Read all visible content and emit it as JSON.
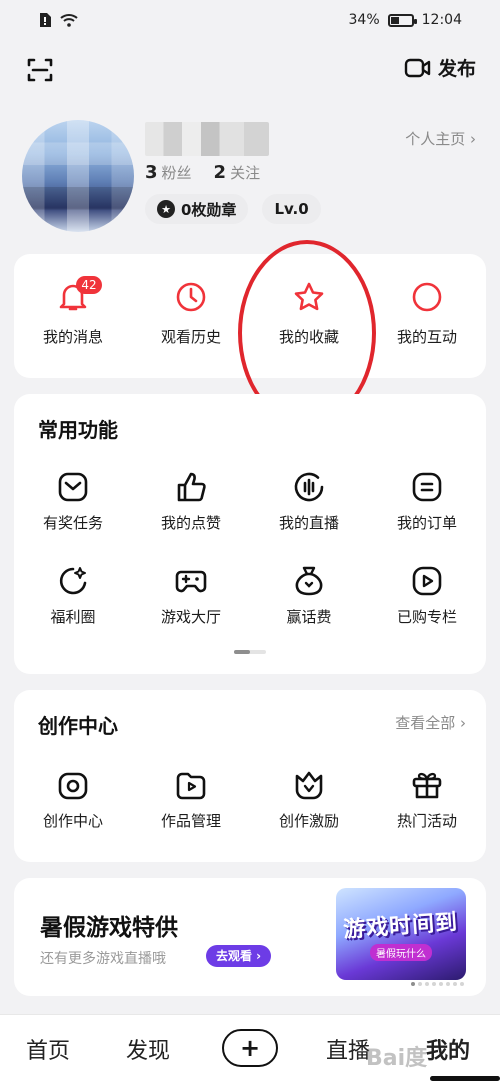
{
  "status": {
    "battery": "34%",
    "time": "12:04"
  },
  "top_bar": {
    "publish": "发布"
  },
  "profile": {
    "profile_link": "个人主页 ›",
    "fans_count": "3",
    "fans_label": "粉丝",
    "follow_count": "2",
    "follow_label": "关注",
    "medals": "0枚勋章",
    "level": "Lv.0"
  },
  "quick_actions": [
    {
      "label": "我的消息",
      "badge": "42"
    },
    {
      "label": "观看历史"
    },
    {
      "label": "我的收藏"
    },
    {
      "label": "我的互动"
    }
  ],
  "common": {
    "title": "常用功能",
    "items": [
      {
        "label": "有奖任务"
      },
      {
        "label": "我的点赞"
      },
      {
        "label": "我的直播"
      },
      {
        "label": "我的订单"
      },
      {
        "label": "福利圈"
      },
      {
        "label": "游戏大厅"
      },
      {
        "label": "赢话费"
      },
      {
        "label": "已购专栏"
      }
    ]
  },
  "create": {
    "title": "创作中心",
    "view_all": "查看全部 ›",
    "items": [
      {
        "label": "创作中心"
      },
      {
        "label": "作品管理"
      },
      {
        "label": "创作激励"
      },
      {
        "label": "热门活动"
      }
    ]
  },
  "promo": {
    "title": "暑假游戏特供",
    "subtitle": "还有更多游戏直播哦",
    "button": "去观看 ›",
    "art_main": "游戏时间到",
    "art_sub": "暑假玩什么"
  },
  "tabs": {
    "home": "首页",
    "discover": "发现",
    "add": "+",
    "live": "直播",
    "mine": "我的"
  },
  "watermark": "Bai度",
  "colors": {
    "accent_red": "#f0333a",
    "annotation": "#e0262d",
    "promo_purple": "#6d3ce6"
  }
}
